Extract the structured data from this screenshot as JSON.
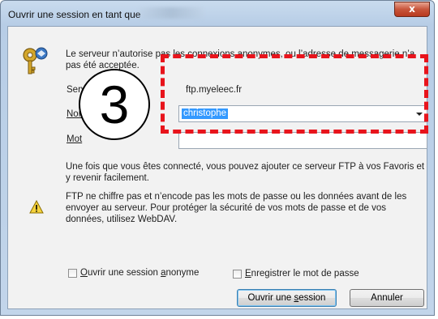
{
  "window": {
    "title": "Ouvrir une session en tant que",
    "close_glyph": "x"
  },
  "dialog": {
    "info_text": "Le serveur n’autorise pas les connexions anonymes, ou l’adresse de messagerie n’a pas été acceptée.",
    "server_label_pre": "Serveur FT",
    "server_value": "ftp.myeleec.fr",
    "username_label_pre": "Nom",
    "username_value": "christophe",
    "password_label_pre": "Mot",
    "favorites_text": "Une fois que vous êtes connecté, vous pouvez ajouter ce serveur FTP à vos Favoris et y revenir facilement.",
    "warning_text": "FTP ne chiffre pas et n’encode pas les mots de passe ou les données avant de les envoyer au serveur. Pour protéger la sécurité de vos mots de passe et de vos données, utilisez WebDAV.",
    "anonymous_checkbox_label_ul": "O",
    "anonymous_checkbox_label_rest": "uvrir une session ",
    "anonymous_checkbox_label_ul2": "a",
    "anonymous_checkbox_label_rest2": "nonyme",
    "save_password_label_ul": "E",
    "save_password_label_rest": "nregistrer le mot de passe",
    "login_button_pre": "Ouvrir une ",
    "login_button_ul": "s",
    "login_button_post": "ession",
    "cancel_button": "Annuler"
  },
  "annotation": {
    "number": "3",
    "color": "#e8141c"
  },
  "colors": {
    "selection": "#3399ff",
    "close_button": "#c8553b"
  },
  "icons": [
    "key-icon",
    "warning-icon",
    "chevron-down-icon",
    "close-icon"
  ]
}
